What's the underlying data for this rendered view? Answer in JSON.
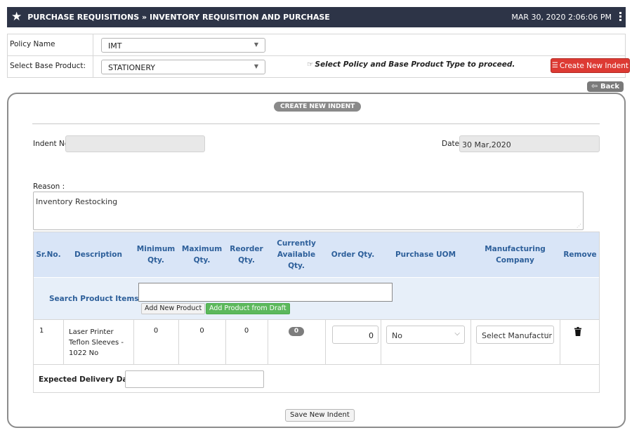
{
  "header": {
    "title": "PURCHASE REQUISITIONS » INVENTORY REQUISITION AND PURCHASE",
    "datetime": "MAR 30, 2020  2:06:06 PM",
    "bg_color": "#2d3447"
  },
  "filters": {
    "policy_label": "Policy Name",
    "policy_value": "IMT",
    "base_label": "Select Base Product:",
    "base_value": "STATIONERY",
    "hint": "Select Policy and Base Product Type to proceed.",
    "create_button": "Create New Indent"
  },
  "back_button": "Back",
  "form": {
    "section_title": "CREATE NEW INDENT",
    "indent_label": "Indent No:",
    "indent_value": "",
    "date_label": "Date:",
    "date_value": "30 Mar,2020",
    "reason_label": "Reason :",
    "reason_value": "Inventory Restocking"
  },
  "table": {
    "headers": {
      "sr": "Sr.No.",
      "description": "Description",
      "min": "Minimum Qty.",
      "max": "Maximum Qty.",
      "reorder": "Reorder Qty.",
      "available": "Currently Available Qty.",
      "order": "Order Qty.",
      "uom": "Purchase UOM",
      "manufacturer": "Manufacturing Company",
      "remove": "Remove"
    },
    "search_label": "Search Product Items",
    "add_new_button": "Add New Product",
    "add_draft_button": "Add Product from Draft",
    "row": {
      "sr": "1",
      "description": "Laser Printer Teflon Sleeves - 1022 No",
      "min": "0",
      "max": "0",
      "reorder": "0",
      "available": "0",
      "order_qty": "0",
      "uom": "No",
      "manufacturer": "Select Manufactur"
    },
    "delivery_label": "Expected Delivery Date:"
  },
  "save_button": "Save New Indent",
  "colors": {
    "accent_red": "#dd3a33",
    "accent_green": "#5cb85c",
    "header_blue": "#2d5f9a",
    "table_header_bg": "#d9e5f7"
  }
}
